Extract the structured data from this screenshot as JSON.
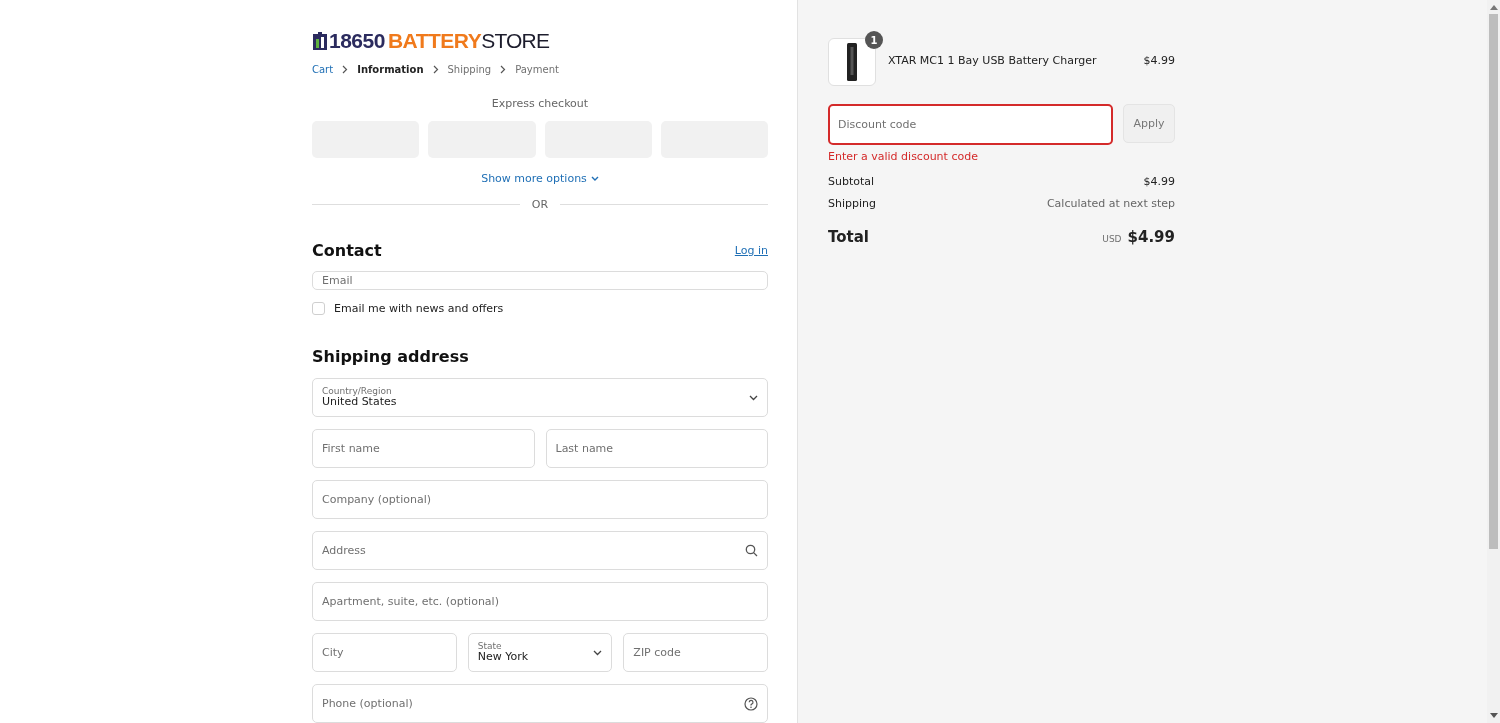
{
  "logo": {
    "number": "18650",
    "word1": "BATTERY",
    "word2": "STORE"
  },
  "breadcrumb": [
    {
      "label": "Cart",
      "kind": "link"
    },
    {
      "label": "Information",
      "kind": "current"
    },
    {
      "label": "Shipping",
      "kind": "pending"
    },
    {
      "label": "Payment",
      "kind": "pending"
    }
  ],
  "express_checkout": {
    "title": "Express checkout",
    "more": "Show more options"
  },
  "divider": "OR",
  "contact": {
    "title": "Contact",
    "login": "Log in",
    "email": {
      "placeholder": "Email"
    },
    "newsletter": {
      "label": "Email me with news and offers",
      "checked": false
    }
  },
  "shipping_address": {
    "title": "Shipping address",
    "rows": [
      [
        {
          "kind": "select",
          "label": "Country/Region",
          "value": "United States"
        }
      ],
      [
        {
          "kind": "text",
          "placeholder": "First name"
        },
        {
          "kind": "text",
          "placeholder": "Last name"
        }
      ],
      [
        {
          "kind": "text",
          "placeholder": "Company (optional)"
        }
      ],
      [
        {
          "kind": "search",
          "placeholder": "Address"
        }
      ],
      [
        {
          "kind": "text",
          "placeholder": "Apartment, suite, etc. (optional)"
        }
      ],
      [
        {
          "kind": "text",
          "placeholder": "City"
        },
        {
          "kind": "select",
          "label": "State",
          "value": "New York"
        },
        {
          "kind": "text",
          "placeholder": "ZIP code"
        }
      ],
      [
        {
          "kind": "help",
          "placeholder": "Phone (optional)"
        }
      ]
    ]
  },
  "summary": {
    "items": [
      {
        "name": "XTAR MC1 1 Bay USB Battery Charger",
        "quantity": "1",
        "price": "$4.99"
      }
    ],
    "discount": {
      "placeholder": "Discount code",
      "button": "Apply",
      "error": "Enter a valid discount code"
    },
    "lines": [
      {
        "label": "Subtotal",
        "value": "$4.99"
      },
      {
        "label": "Shipping",
        "value": "Calculated at next step"
      }
    ],
    "total": {
      "label": "Total",
      "currency": "USD",
      "value": "$4.99"
    }
  }
}
